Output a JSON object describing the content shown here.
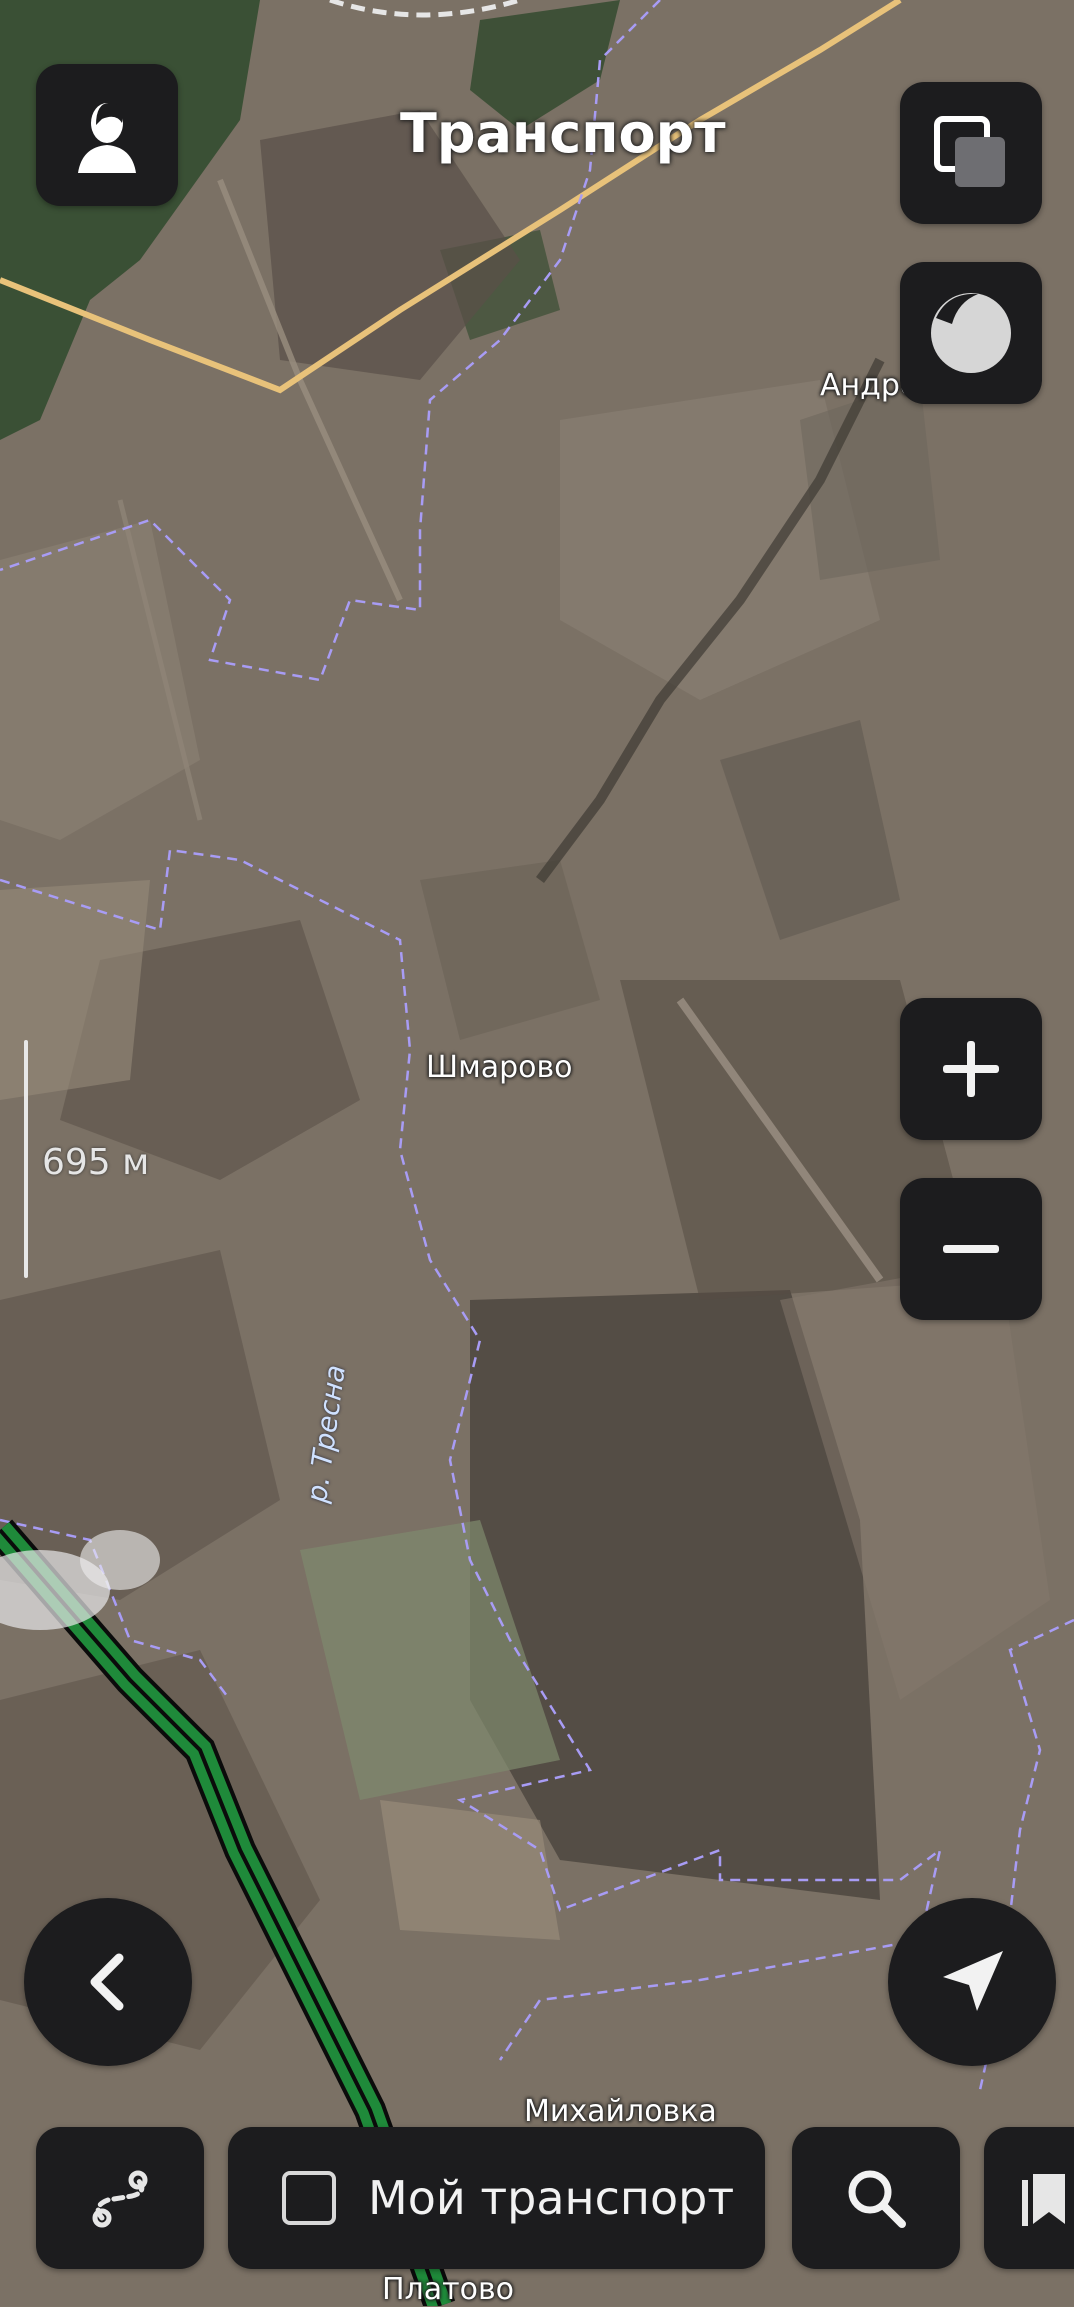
{
  "header": {
    "title": "Транспорт"
  },
  "map": {
    "settlements": {
      "andreevka": "Андреевка",
      "shmarovo": "Шмарово",
      "mikhaylovka": "Михайловка",
      "platovo": "Платово"
    },
    "river": "р. Тресна",
    "scale": "695 м"
  },
  "toolbar": {
    "my_transport": "Мой транспорт"
  },
  "icons": {
    "profile": "profile-icon",
    "layers": "layers-icon",
    "theme": "theme-icon",
    "zoom_in": "plus-icon",
    "zoom_out": "minus-icon",
    "back": "chevron-left-icon",
    "location": "location-arrow-icon",
    "route": "route-icon",
    "search": "search-icon",
    "bookmarks": "bookmark-icon"
  },
  "colors": {
    "button_bg": "#1c1c1e",
    "route_line": "#1f8a3a",
    "boundary": "#a89cf5",
    "road": "#e8c27a"
  }
}
